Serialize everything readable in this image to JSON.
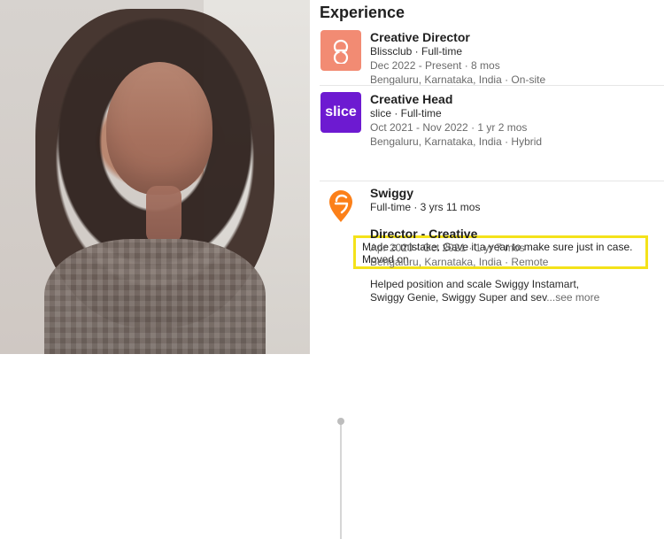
{
  "experience": {
    "heading": "Experience",
    "items": [
      {
        "title": "Creative Director",
        "company_line": "Blissclub · Full-time",
        "dates_line": "Dec 2022 - Present · 8 mos",
        "location_line": "Bengaluru, Karnataka, India · On-site",
        "logo_icon": "blissclub-logo-icon"
      },
      {
        "title": "Creative Head",
        "company_line": "slice · Full-time",
        "dates_line": "Oct 2021 - Nov 2022 · 1 yr 2 mos",
        "location_line": "Bengaluru, Karnataka, India · Hybrid",
        "logo_text": "slice",
        "note": "Made a mistake. Gave it a year to make sure just in case. Moved on.",
        "highlight_color": "#f4e21a"
      },
      {
        "company": "Swiggy",
        "summary_line": "Full-time · 3 yrs 11 mos",
        "role": {
          "title": "Director - Creative",
          "dates_line": "Apr 2020 - Oct 2021 · 1 yr 7 mos",
          "location_line": "Bengaluru, Karnataka, India · Remote",
          "desc_line1": "Helped position and scale Swiggy Instamart,",
          "desc_line2": "Swiggy Genie, Swiggy Super and sev",
          "see_more": "...see more"
        },
        "logo_icon": "swiggy-logo-icon"
      }
    ]
  },
  "colors": {
    "slice": "#6d1ad1",
    "blissclub": "#f28b73",
    "swiggy": "#fc8019",
    "highlight": "#f4e21a"
  }
}
